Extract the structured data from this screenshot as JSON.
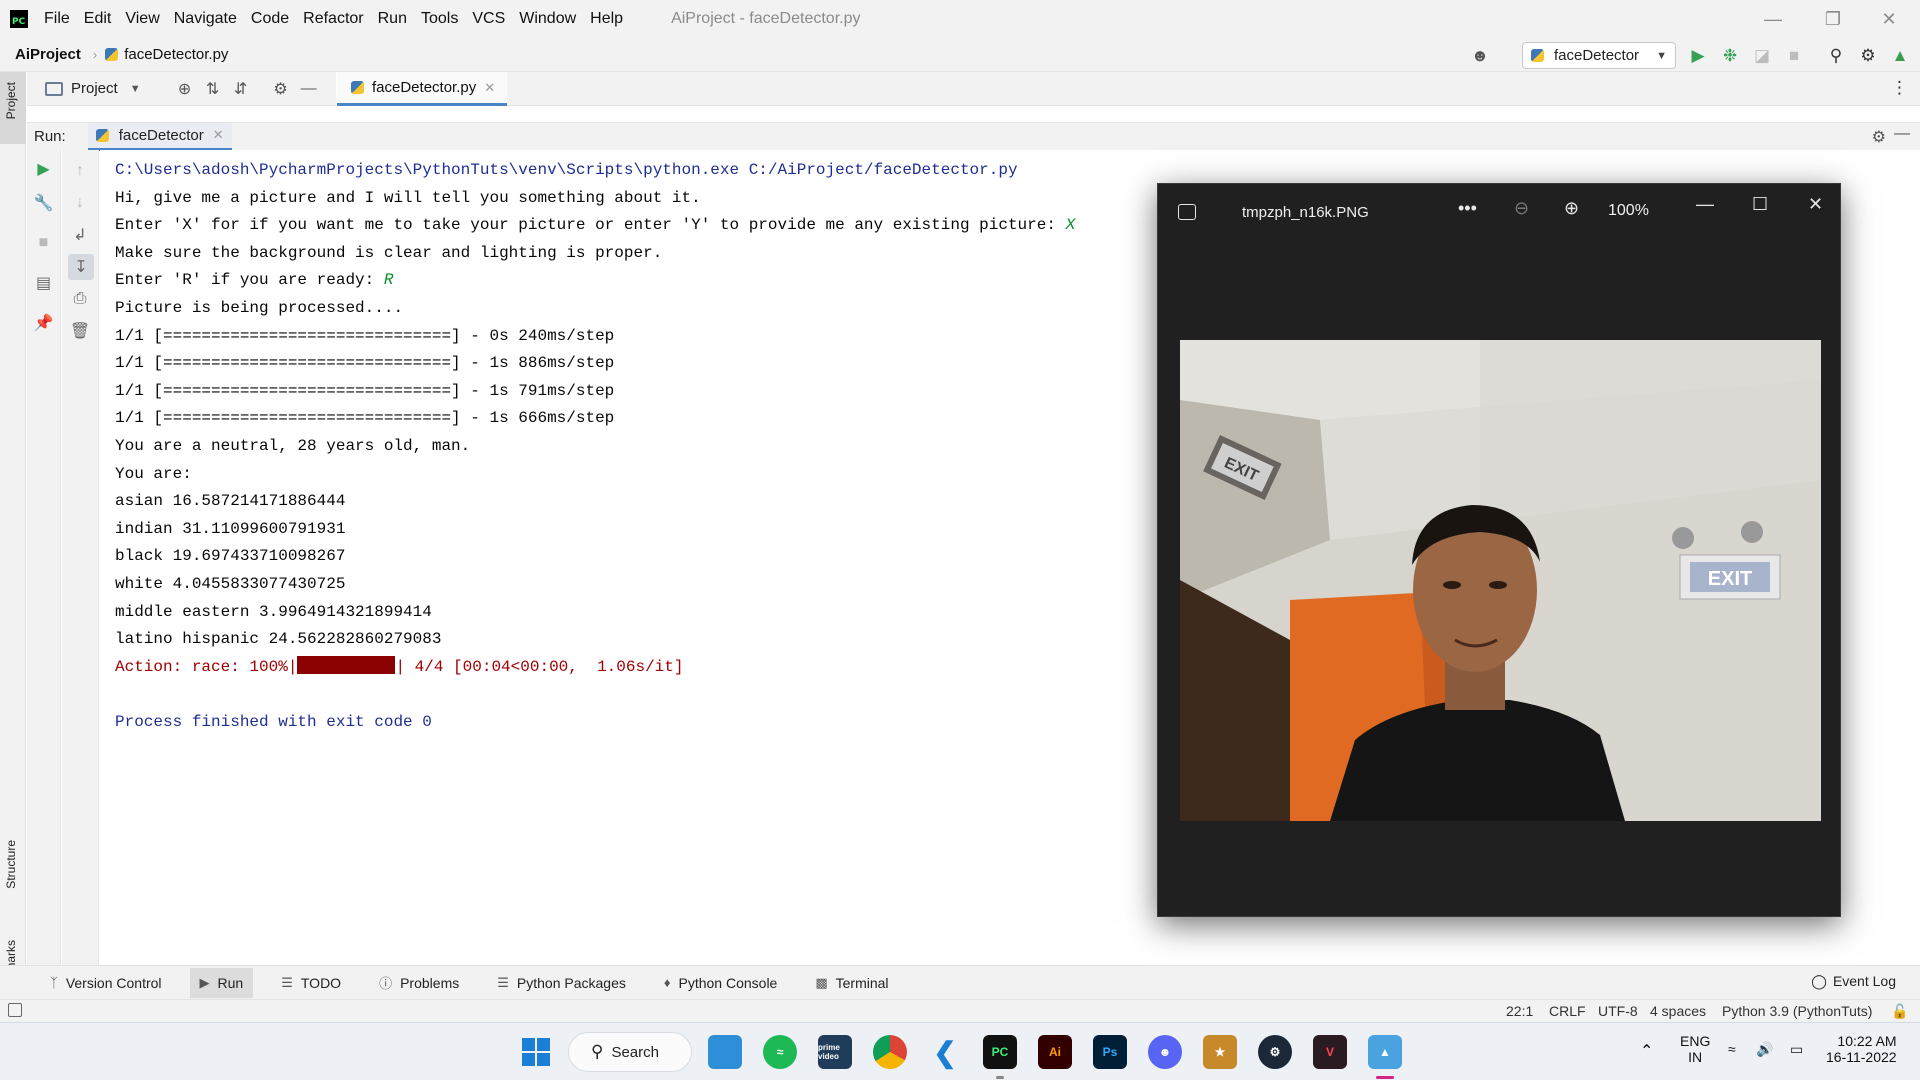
{
  "menubar": {
    "items": [
      "File",
      "Edit",
      "View",
      "Navigate",
      "Code",
      "Refactor",
      "Run",
      "Tools",
      "VCS",
      "Window",
      "Help"
    ],
    "window_title": "AiProject - faceDetector.py"
  },
  "navbar": {
    "project": "AiProject",
    "file": "faceDetector.py",
    "run_config": "faceDetector"
  },
  "project_panel": {
    "label": "Project"
  },
  "editor": {
    "tab": "faceDetector.py"
  },
  "left_stripe": {
    "project": "Project",
    "structure": "Structure",
    "bookmarks": "Bookmarks"
  },
  "run_panel": {
    "title": "Run:",
    "tab": "faceDetector"
  },
  "console": {
    "command": "C:\\Users\\adosh\\PycharmProjects\\PythonTuts\\venv\\Scripts\\python.exe C:/AiProject/faceDetector.py",
    "line1": "Hi, give me a picture and I will tell you something about it.",
    "line2_prompt": "Enter 'X' for if you want me to take your picture or enter 'Y' to provide me any existing picture: ",
    "line2_input": "X",
    "line3": "Make sure the background is clear and lighting is proper.",
    "line4_prompt": "Enter 'R' if you are ready: ",
    "line4_input": "R",
    "line5": "Picture is being processed....",
    "steps": [
      "1/1 [==============================] - 0s 240ms/step",
      "1/1 [==============================] - 1s 886ms/step",
      "1/1 [==============================] - 1s 791ms/step",
      "1/1 [==============================] - 1s 666ms/step"
    ],
    "summary": "You are a neutral, 28 years old, man.",
    "you_are": "You are:",
    "races": [
      "asian 16.587214171886444",
      "indian 31.11099600791931",
      "black 19.697433710098267",
      "white 4.0455833077430725",
      "middle eastern 3.9964914321899414",
      "latino hispanic 24.562282860279083"
    ],
    "action_prefix": "Action: race: 100%|",
    "action_suffix": "| 4/4 [00:04<00:00,  1.06s/it]",
    "exit": "Process finished with exit code 0"
  },
  "bottom_tabs": {
    "version_control": "Version Control",
    "run": "Run",
    "todo": "TODO",
    "problems": "Problems",
    "python_packages": "Python Packages",
    "python_console": "Python Console",
    "terminal": "Terminal",
    "event_log": "Event Log"
  },
  "status": {
    "position": "22:1",
    "line_sep": "CRLF",
    "encoding": "UTF-8",
    "indent": "4 spaces",
    "interpreter": "Python 3.9 (PythonTuts)"
  },
  "viewer": {
    "filename": "tmpzph_n16k.PNG",
    "zoom": "100%",
    "photo": {
      "exit_sign_left": "EXIT",
      "exit_sign_right": "EXIT"
    }
  },
  "taskbar": {
    "search": "Search",
    "lang_top": "ENG",
    "lang_bottom": "IN",
    "time": "10:22 AM",
    "date": "16-11-2022",
    "apps": {
      "prime": "prime video",
      "pycharm": "PC",
      "illustrator": "Ai",
      "photoshop": "Ps"
    }
  },
  "colors": {
    "console_system": "#1f2d95",
    "console_error": "#a00000",
    "console_input": "#0a8a2a",
    "run_green": "#35a155",
    "accent_tab": "#4a86c7"
  }
}
